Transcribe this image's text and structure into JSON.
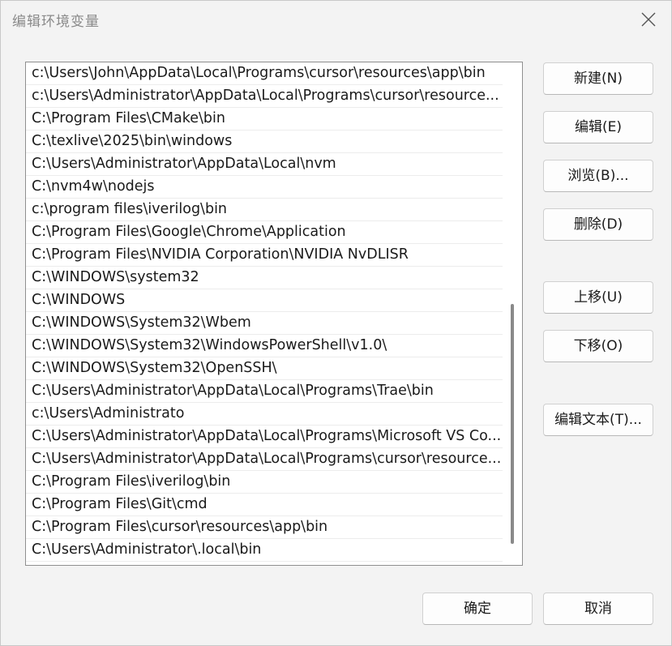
{
  "window": {
    "title": "编辑环境变量",
    "close_icon": "close-icon"
  },
  "paths": [
    "c:\\Users\\John\\AppData\\Local\\Programs\\cursor\\resources\\app\\bin",
    "c:\\Users\\Administrator\\AppData\\Local\\Programs\\cursor\\resource...",
    "C:\\Program Files\\CMake\\bin",
    "C:\\texlive\\2025\\bin\\windows",
    "C:\\Users\\Administrator\\AppData\\Local\\nvm",
    "C:\\nvm4w\\nodejs",
    "c:\\program files\\iverilog\\bin",
    "C:\\Program Files\\Google\\Chrome\\Application",
    "C:\\Program Files\\NVIDIA Corporation\\NVIDIA NvDLISR",
    "C:\\WINDOWS\\system32",
    "C:\\WINDOWS",
    "C:\\WINDOWS\\System32\\Wbem",
    "C:\\WINDOWS\\System32\\WindowsPowerShell\\v1.0\\",
    "C:\\WINDOWS\\System32\\OpenSSH\\",
    "C:\\Users\\Administrator\\AppData\\Local\\Programs\\Trae\\bin",
    "c:\\Users\\Administrato",
    "C:\\Users\\Administrator\\AppData\\Local\\Programs\\Microsoft VS Co...",
    "C:\\Users\\Administrator\\AppData\\Local\\Programs\\cursor\\resource...",
    "C:\\Program Files\\iverilog\\bin",
    "C:\\Program Files\\Git\\cmd",
    "C:\\Program Files\\cursor\\resources\\app\\bin",
    "C:\\Users\\Administrator\\.local\\bin"
  ],
  "buttons": {
    "new": "新建(N)",
    "edit": "编辑(E)",
    "browse": "浏览(B)...",
    "delete": "删除(D)",
    "move_up": "上移(U)",
    "move_down": "下移(O)",
    "edit_text": "编辑文本(T)...",
    "ok": "确定",
    "cancel": "取消"
  }
}
